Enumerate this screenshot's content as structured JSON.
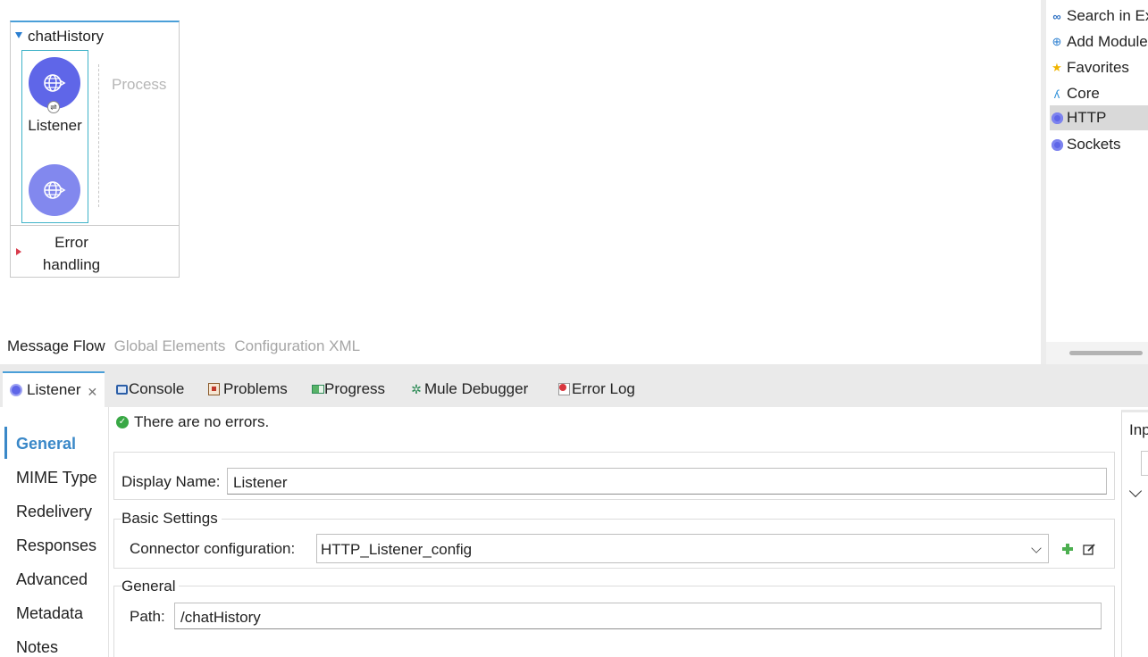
{
  "flow": {
    "name": "chatHistory",
    "source_label": "Listener",
    "process_label": "Process",
    "error_handling_label": "Error\nhandling"
  },
  "editor_tabs": [
    {
      "label": "Message Flow",
      "active": true
    },
    {
      "label": "Global Elements",
      "active": false
    },
    {
      "label": "Configuration XML",
      "active": false
    }
  ],
  "palette": {
    "items": [
      {
        "label": "Search in Exchange",
        "icon": "exchange-icon"
      },
      {
        "label": "Add Modules",
        "icon": "add-module-icon"
      },
      {
        "label": "Favorites",
        "icon": "star-icon"
      },
      {
        "label": "Core",
        "icon": "mule-core-icon"
      },
      {
        "label": "HTTP",
        "icon": "http-icon",
        "selected": true
      },
      {
        "label": "Sockets",
        "icon": "sockets-icon"
      }
    ]
  },
  "bottom_tabs": [
    {
      "label": "Listener",
      "icon": "listener-icon",
      "active": true,
      "closable": true
    },
    {
      "label": "Console",
      "icon": "console-icon"
    },
    {
      "label": "Problems",
      "icon": "problems-icon"
    },
    {
      "label": "Progress",
      "icon": "progress-icon"
    },
    {
      "label": "Mule Debugger",
      "icon": "debugger-icon"
    },
    {
      "label": "Error Log",
      "icon": "error-log-icon"
    }
  ],
  "side_nav": [
    {
      "label": "General",
      "active": true
    },
    {
      "label": "MIME Type"
    },
    {
      "label": "Redelivery"
    },
    {
      "label": "Responses"
    },
    {
      "label": "Advanced"
    },
    {
      "label": "Metadata"
    },
    {
      "label": "Notes"
    }
  ],
  "properties": {
    "status": "There are no errors.",
    "display_name_label": "Display Name:",
    "display_name_value": "Listener",
    "basic_settings_title": "Basic Settings",
    "connector_config_label": "Connector configuration:",
    "connector_config_value": "HTTP_Listener_config",
    "general_title": "General",
    "path_label": "Path:",
    "path_value": "/chatHistory"
  },
  "right_panel": {
    "label": "Inp"
  },
  "colors": {
    "accent": "#4a9fd8",
    "connector": "#5f66e8",
    "active_nav": "#3a88c8",
    "ok": "#39a845"
  }
}
